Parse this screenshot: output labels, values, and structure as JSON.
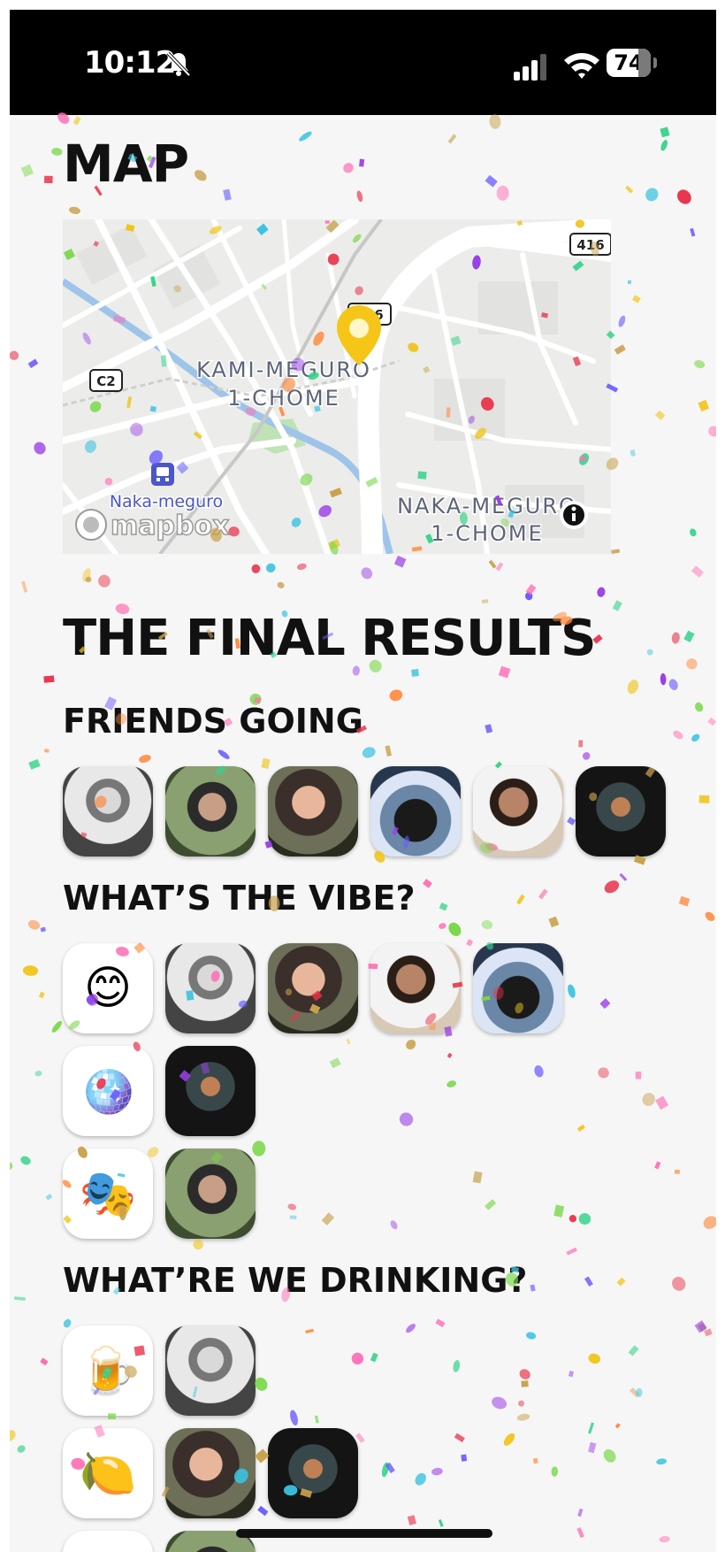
{
  "status_bar": {
    "time": "10:12",
    "battery_level": "74",
    "icons": [
      "bell-slash-icon",
      "cellular-signal-icon",
      "wifi-icon",
      "battery-icon"
    ]
  },
  "map_section": {
    "title": "MAP",
    "map": {
      "labels": {
        "area_1_line1": "KAMI-MEGURO",
        "area_1_line2": "1-CHOME",
        "area_2_line1": "NAKA-MEGURO",
        "area_2_line2": "1-CHOME",
        "station": "Naka-meguro",
        "route_416_a": "416",
        "route_416_b": "416",
        "route_c2": "C2",
        "attribution": "mapbox"
      },
      "colors": {
        "land": "#ececea",
        "road": "#ffffff",
        "river": "#9ec4ea",
        "park": "#bfe3b4",
        "pin": "#f5c518"
      }
    }
  },
  "results": {
    "title": "THE FINAL RESULTS",
    "friends_going": {
      "title": "FRIENDS GOING",
      "avatars": [
        "avatar-bw",
        "avatar-selfie",
        "avatar-bald",
        "avatar-lights",
        "avatar-white",
        "avatar-night"
      ]
    },
    "vibe": {
      "title": "WHAT’S THE VIBE?",
      "options": [
        {
          "emoji": "😊",
          "voters": [
            "avatar-bw",
            "avatar-bald",
            "avatar-white",
            "avatar-lights"
          ]
        },
        {
          "emoji": "🪩",
          "voters": [
            "avatar-night"
          ]
        },
        {
          "emoji": "🎭",
          "voters": [
            "avatar-selfie"
          ]
        }
      ]
    },
    "drinks": {
      "title": "WHAT’RE WE DRINKING?",
      "options": [
        {
          "emoji": "🍺",
          "voters": [
            "avatar-bw"
          ]
        },
        {
          "emoji": "🍋",
          "voters": [
            "avatar-bald",
            "avatar-night"
          ]
        }
      ]
    }
  },
  "colors": {
    "background": "#f6f6f6",
    "status_bar": "#000000",
    "heading": "#111111"
  }
}
